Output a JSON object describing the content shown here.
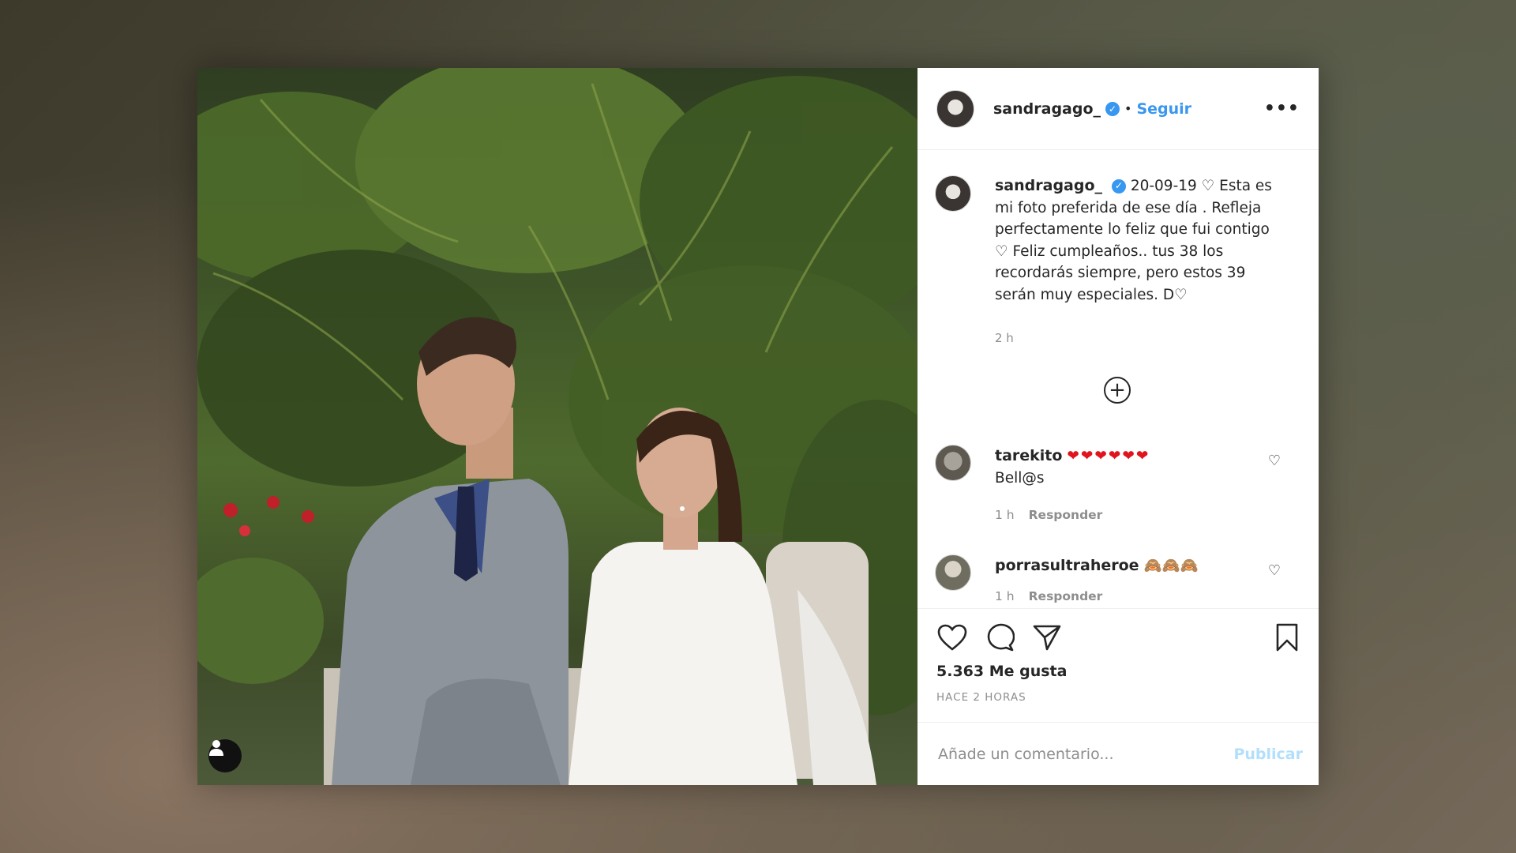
{
  "colors": {
    "accent": "#3897f0",
    "heart": "#e0141e",
    "publish_disabled": "#b2dffc"
  },
  "header": {
    "username": "sandragago_",
    "verified_icon": "✓",
    "separator": "•",
    "follow_label": "Seguir",
    "more_label": "•••"
  },
  "caption": {
    "username": "sandragago_",
    "text": "20-09-19 ♡ Esta es mi foto preferida de ese día . Refleja perfectamente lo feliz que fui contigo ♡ Feliz cumpleaños.. tus 38 los recordarás siempre, pero estos 39 serán muy especiales. D♡",
    "time": "2 h"
  },
  "load_more_label": "+",
  "comments": [
    {
      "username": "tarekito",
      "emojis": "❤❤❤❤❤❤",
      "text": "Bell@s",
      "time": "1 h",
      "reply": "Responder"
    },
    {
      "username": "porrasultraheroe",
      "emojis": "🙈🙈🙈",
      "text": "",
      "time": "1 h",
      "reply": "Responder"
    }
  ],
  "likes": "5.363 Me gusta",
  "posted_ago": "HACE 2 HORAS",
  "comment_input": {
    "placeholder": "Añade un comentario...",
    "value": ""
  },
  "publish_label": "Publicar",
  "icons": [
    "heart-icon",
    "comment-icon",
    "share-icon",
    "bookmark-icon",
    "user-tag-icon"
  ]
}
